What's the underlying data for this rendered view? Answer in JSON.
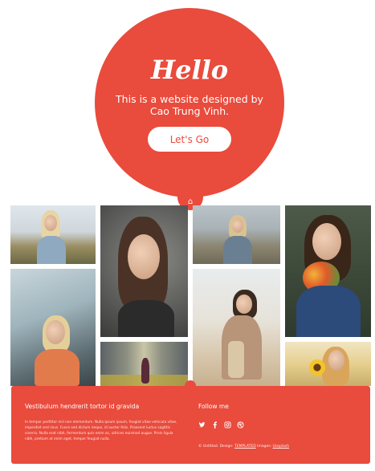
{
  "hero": {
    "title": "Hello",
    "text": "This is a website designed by Cao Trung Vinh.",
    "button_label": "Let's Go",
    "home_icon": "home-icon"
  },
  "gallery": {
    "photos": [
      {
        "name": "photo-woman-field"
      },
      {
        "name": "photo-woman-portrait-dark"
      },
      {
        "name": "photo-woman-cliff"
      },
      {
        "name": "photo-woman-flowers"
      },
      {
        "name": "photo-woman-car-window"
      },
      {
        "name": "photo-woman-sand-beach"
      },
      {
        "name": "photo-corridor-figure"
      },
      {
        "name": "photo-woman-sunflower"
      }
    ]
  },
  "footer": {
    "heading": "Vestibulum hendrerit tortor id gravida",
    "text": "In tempor porttitor nisl non elementum. Nulla ipsum ipsum, feugiat vitae vehicula vitae, imperdiet sed risus. Fusce sed dictum neque, id auctor felis. Praesent luctus sagittis viverra. Nulla erat nibh, fermentum quis enim ac, ultrices euismod augue. Proin ligula nibh, pretium at enim eget, tempor feugiat nulla.",
    "follow_heading": "Follow me",
    "social": [
      "twitter-icon",
      "facebook-icon",
      "instagram-icon",
      "dribbble-icon"
    ],
    "credits_prefix": "© Untitled. Design:",
    "credits_design_link": "TEMPLATED",
    "credits_images_label": "Images:",
    "credits_images_link": "Unsplash"
  },
  "colors": {
    "accent": "#e94b3c",
    "background": "#ffffff"
  }
}
